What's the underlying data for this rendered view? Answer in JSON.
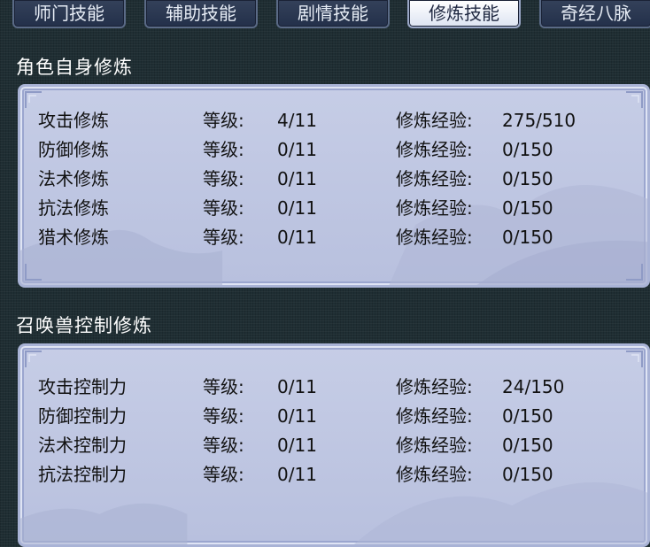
{
  "tabs": [
    {
      "label": "师门技能",
      "active": false
    },
    {
      "label": "辅助技能",
      "active": false
    },
    {
      "label": "剧情技能",
      "active": false
    },
    {
      "label": "修炼技能",
      "active": true
    },
    {
      "label": "奇经八脉",
      "active": false
    }
  ],
  "labels": {
    "level": "等级:",
    "exp": "修炼经验:"
  },
  "self_cultivation": {
    "title": "角色自身修炼",
    "rows": [
      {
        "name": "攻击修炼",
        "level": "4/11",
        "exp": "275/510"
      },
      {
        "name": "防御修炼",
        "level": "0/11",
        "exp": "0/150"
      },
      {
        "name": "法术修炼",
        "level": "0/11",
        "exp": "0/150"
      },
      {
        "name": "抗法修炼",
        "level": "0/11",
        "exp": "0/150"
      },
      {
        "name": "猎术修炼",
        "level": "0/11",
        "exp": "0/150"
      }
    ]
  },
  "pet_control": {
    "title": "召唤兽控制修炼",
    "rows": [
      {
        "name": "攻击控制力",
        "level": "0/11",
        "exp": "24/150"
      },
      {
        "name": "防御控制力",
        "level": "0/11",
        "exp": "0/150"
      },
      {
        "name": "法术控制力",
        "level": "0/11",
        "exp": "0/150"
      },
      {
        "name": "抗法控制力",
        "level": "0/11",
        "exp": "0/150"
      }
    ]
  }
}
